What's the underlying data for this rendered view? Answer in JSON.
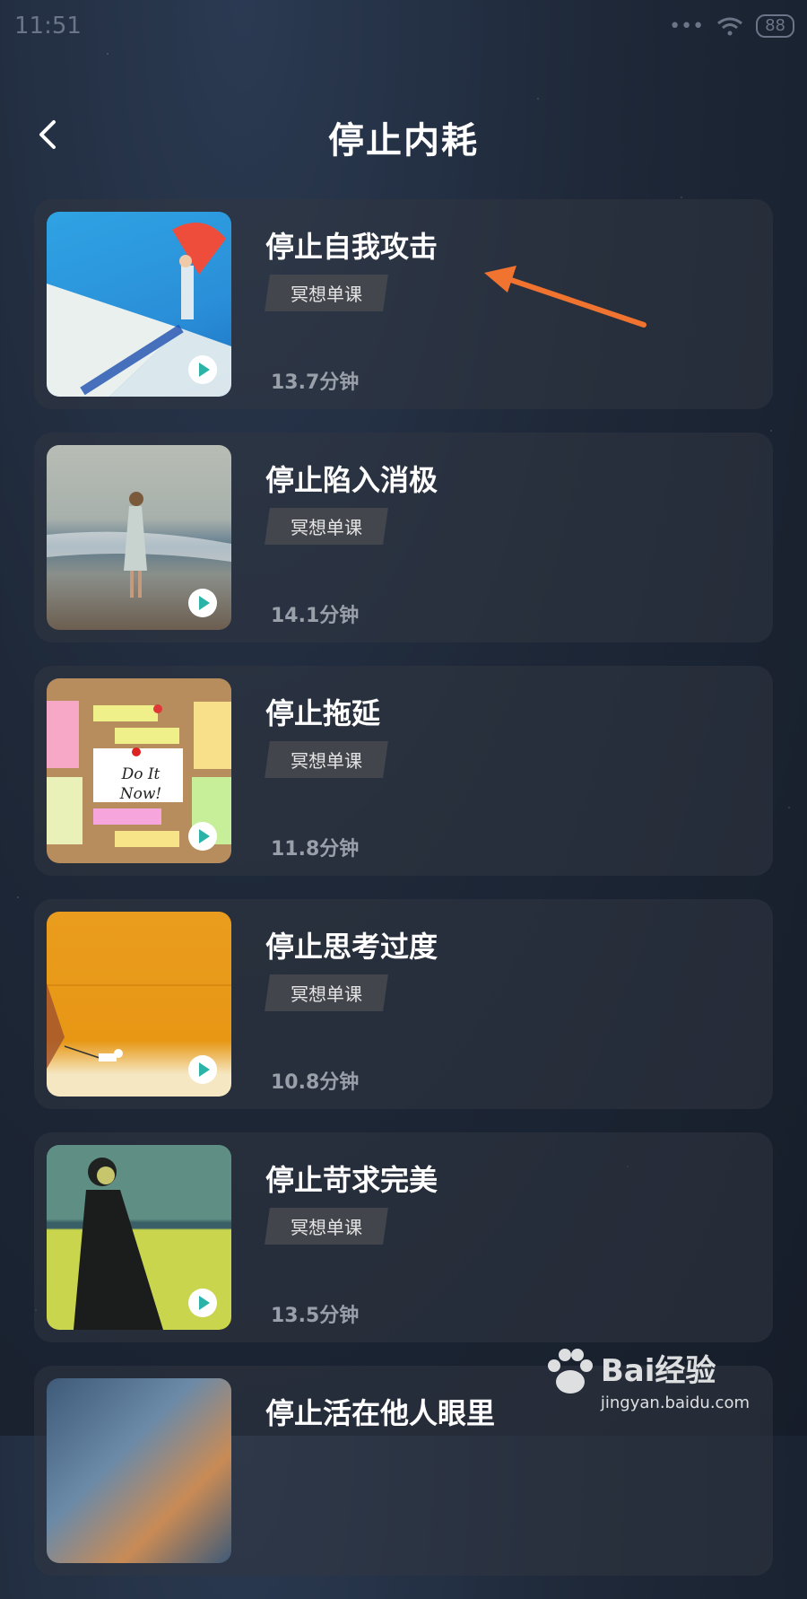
{
  "status": {
    "time": "11:51",
    "battery": "88"
  },
  "header": {
    "title": "停止内耗"
  },
  "courses": [
    {
      "title": "停止自我攻击",
      "tag": "冥想单课",
      "duration": "13.7分钟"
    },
    {
      "title": "停止陷入消极",
      "tag": "冥想单课",
      "duration": "14.1分钟"
    },
    {
      "title": "停止拖延",
      "tag": "冥想单课",
      "duration": "11.8分钟",
      "note_text": "Do It Now!"
    },
    {
      "title": "停止思考过度",
      "tag": "冥想单课",
      "duration": "10.8分钟"
    },
    {
      "title": "停止苛求完美",
      "tag": "冥想单课",
      "duration": "13.5分钟"
    },
    {
      "title": "停止活在他人眼里"
    }
  ],
  "watermark": {
    "brand": "Bai经验",
    "url": "jingyan.baidu.com"
  },
  "colors": {
    "arrow": "#f07430",
    "play": "#2bb3a7"
  }
}
